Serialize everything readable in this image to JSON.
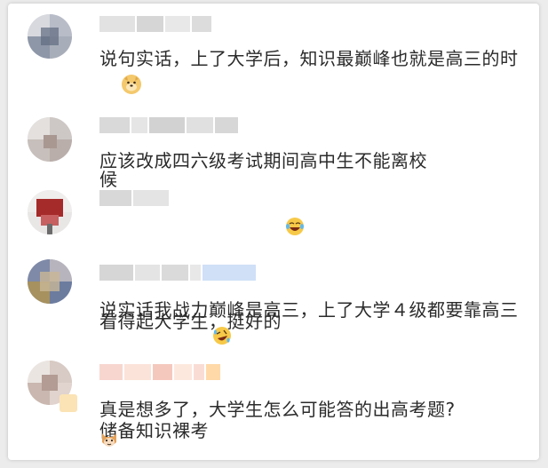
{
  "comments": [
    {
      "text": "说句实话，上了大学后，知识最巅峰也就是高三的时候",
      "emoji": "doge-emoji"
    },
    {
      "text": "应该改成四六级考试期间高中生不能离校",
      "emoji": ""
    },
    {
      "text": "看得起大学生，挺好的",
      "emoji": "laughing-tears-emoji"
    },
    {
      "text": "说实话我战力巅峰是高三，上了大学４级都要靠高三储备知识裸考",
      "emoji": "rolling-laugh-emoji"
    },
    {
      "text": "真是想多了，大学生怎么可能答的出高考题?",
      "emoji": "cat-emoji"
    }
  ]
}
